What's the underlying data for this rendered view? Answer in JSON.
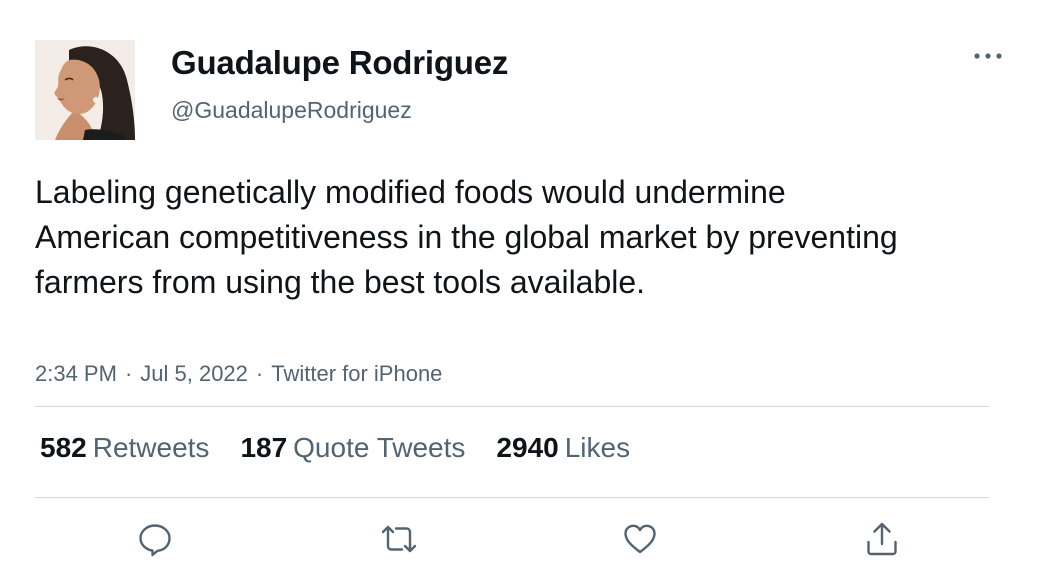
{
  "user": {
    "display_name": "Guadalupe Rodriguez",
    "handle": "@GuadalupeRodriguez"
  },
  "tweet": {
    "text": "Labeling genetically modified foods would undermine American competitiveness in the global market by preventing farmers from using the best tools available.",
    "time": "2:34 PM",
    "date": "Jul 5, 2022",
    "source": "Twitter for iPhone",
    "separator": "·"
  },
  "stats": {
    "retweets_count": "582",
    "retweets_label": "Retweets",
    "quotes_count": "187",
    "quotes_label": "Quote Tweets",
    "likes_count": "2940",
    "likes_label": "Likes"
  },
  "icons": {
    "more": "more-horizontal-icon",
    "reply": "reply-icon",
    "retweet": "retweet-icon",
    "like": "heart-icon",
    "share": "share-icon"
  },
  "colors": {
    "text_primary": "#0f1419",
    "text_secondary": "#536471",
    "divider": "#cfd9de"
  }
}
